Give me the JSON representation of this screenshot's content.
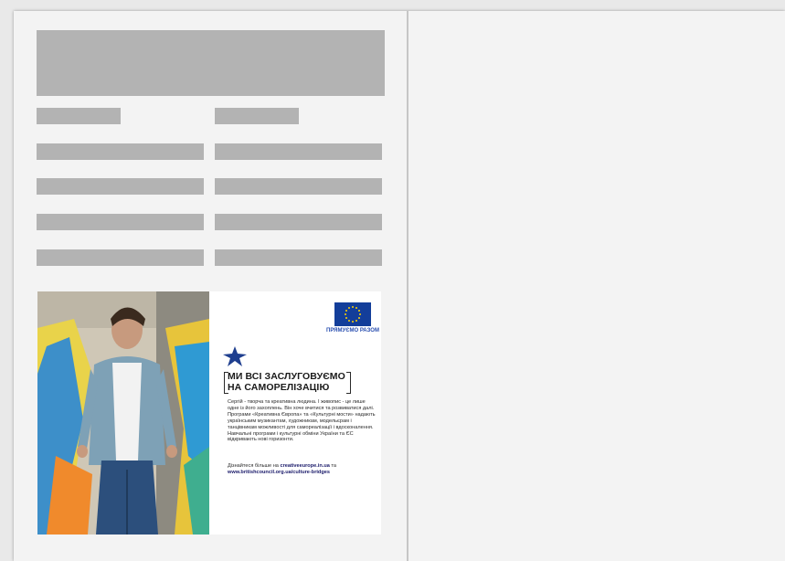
{
  "ad": {
    "eu_caption": "ПРЯМУЄМО РАЗОМ",
    "headline_line1": "МИ ВСІ ЗАСЛУГОВУЄМО",
    "headline_line2": "НА САМОРЕЛІЗАЦІЮ",
    "body": "Сергій - творча та креативна людина. І живопис - це лише одне із його захоплень. Він хоче вчитися та розвиватися далі. Програми «Креативна Європа» та «Культурні мости» надають українським музикантам, художникам, модельєрам і танцівникам можливості для самореалізації і вдосконалення. Навчальні програми і культурні обміни України та ЄС відкривають нові горизонти.",
    "links_prefix": "Дізнайтеся більше на",
    "link1": "creativeeurope.in.ua",
    "links_and": "та",
    "link2": "www.britishcouncil.org.ua/culture-bridges"
  },
  "colors": {
    "placeholder": "#b3b3b3",
    "eu_blue": "#133e9a",
    "star_blue": "#1f3f8f"
  }
}
